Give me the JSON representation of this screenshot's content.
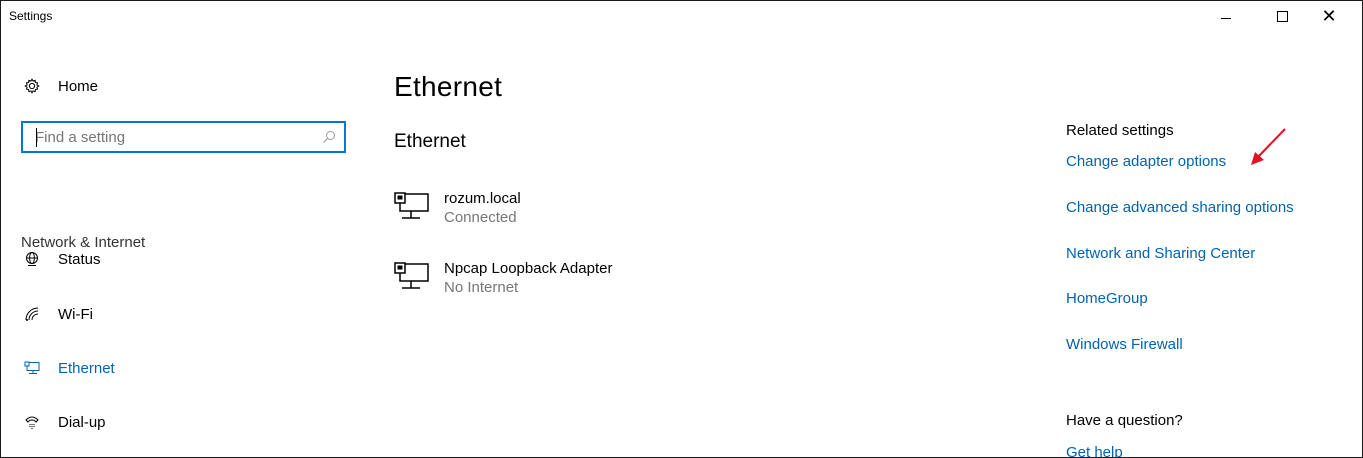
{
  "window": {
    "title": "Settings",
    "minimize_glyph": "",
    "maximize_glyph": "",
    "close_glyph": "✕"
  },
  "sidebar": {
    "home": {
      "label": "Home",
      "icon": "gear-icon"
    },
    "search": {
      "placeholder": "Find a setting",
      "value": ""
    },
    "section_label": "Network & Internet",
    "items": [
      {
        "label": "Status",
        "icon": "globe-icon",
        "active": false
      },
      {
        "label": "Wi-Fi",
        "icon": "wifi-icon",
        "active": false
      },
      {
        "label": "Ethernet",
        "icon": "ethernet-icon",
        "active": true
      },
      {
        "label": "Dial-up",
        "icon": "dialup-icon",
        "active": false
      }
    ]
  },
  "main": {
    "page_title": "Ethernet",
    "section_title": "Ethernet",
    "adapters": [
      {
        "name": "rozum.local",
        "status": "Connected"
      },
      {
        "name": "Npcap Loopback Adapter",
        "status": "No Internet"
      }
    ]
  },
  "related": {
    "heading": "Related settings",
    "links": [
      "Change adapter options",
      "Change advanced sharing options",
      "Network and Sharing Center",
      "HomeGroup",
      "Windows Firewall"
    ],
    "question_heading": "Have a question?",
    "help_link": "Get help"
  },
  "colors": {
    "accent": "#0078d7",
    "link": "#0063b1",
    "annotation_arrow": "#e81123"
  }
}
